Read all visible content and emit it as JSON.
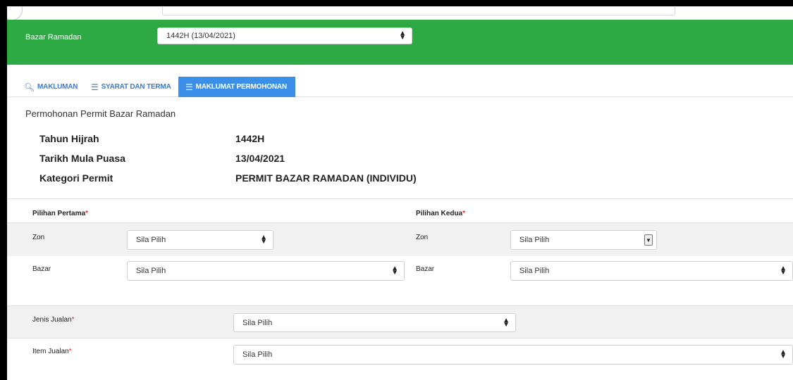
{
  "header": {
    "program_label": "Bazar Ramadan",
    "program_select_value": "1442H (13/04/2021)"
  },
  "tabs": [
    {
      "label": "MAKLUMAN",
      "icon": "search-icon"
    },
    {
      "label": "SYARAT DAN TERMA",
      "icon": "list-icon"
    },
    {
      "label": "MAKLUMAT PERMOHONAN",
      "icon": "list-icon",
      "active": true
    }
  ],
  "page_title": "Permohonan Permit Bazar Ramadan",
  "info": {
    "tahun_label": "Tahun Hijrah",
    "tahun_value": "1442H",
    "tarikh_label": "Tarikh Mula Puasa",
    "tarikh_value": "13/04/2021",
    "kategori_label": "Kategori Permit",
    "kategori_value": "PERMIT BAZAR RAMADAN (INDIVIDU)"
  },
  "pilihan_pertama": {
    "heading": "Pilihan Pertama",
    "zon_label": "Zon",
    "zon_value": "Sila Pilih",
    "bazar_label": "Bazar",
    "bazar_value": "Sila Pilih"
  },
  "pilihan_kedua": {
    "heading": "Pilihan Kedua",
    "zon_label": "Zon",
    "zon_value": "Sila Pilih",
    "bazar_label": "Bazar",
    "bazar_value": "Sila Pilih"
  },
  "jualan": {
    "jenis_label": "Jenis Jualan",
    "jenis_value": "Sila Pilih",
    "item_label": "Item Jualan",
    "item_value": "Sila Pilih"
  },
  "required_mark": "*",
  "colors": {
    "header_green": "#2eaa45",
    "active_tab": "#3b8fe8",
    "tab_text": "#3a7bd5",
    "required": "#e52b2b"
  }
}
